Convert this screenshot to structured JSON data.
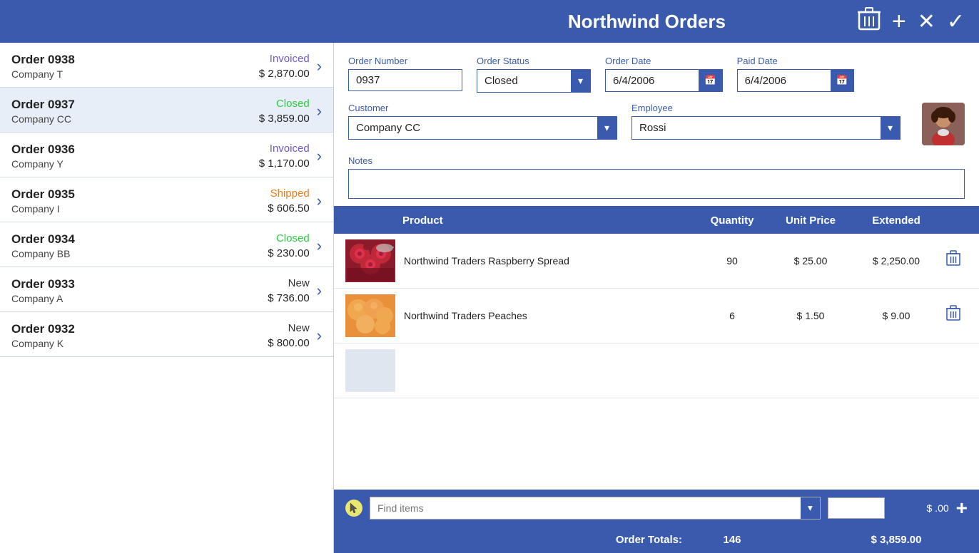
{
  "app": {
    "title": "Northwind Orders"
  },
  "header": {
    "delete_icon": "🗑",
    "add_icon": "+",
    "cancel_icon": "✕",
    "confirm_icon": "✓"
  },
  "orders": [
    {
      "id": "0938",
      "number": "Order 0938",
      "status": "Invoiced",
      "status_class": "status-invoiced",
      "company": "Company T",
      "amount": "$ 2,870.00"
    },
    {
      "id": "0937",
      "number": "Order 0937",
      "status": "Closed",
      "status_class": "status-closed",
      "company": "Company CC",
      "amount": "$ 3,859.00",
      "selected": true
    },
    {
      "id": "0936",
      "number": "Order 0936",
      "status": "Invoiced",
      "status_class": "status-invoiced",
      "company": "Company Y",
      "amount": "$ 1,170.00"
    },
    {
      "id": "0935",
      "number": "Order 0935",
      "status": "Shipped",
      "status_class": "status-shipped",
      "company": "Company I",
      "amount": "$ 606.50"
    },
    {
      "id": "0934",
      "number": "Order 0934",
      "status": "Closed",
      "status_class": "status-closed",
      "company": "Company BB",
      "amount": "$ 230.00"
    },
    {
      "id": "0933",
      "number": "Order 0933",
      "status": "New",
      "status_class": "status-new",
      "company": "Company A",
      "amount": "$ 736.00"
    },
    {
      "id": "0932",
      "number": "Order 0932",
      "status": "New",
      "status_class": "status-new",
      "company": "Company K",
      "amount": "$ 800.00"
    }
  ],
  "detail": {
    "order_number_label": "Order Number",
    "order_number_value": "0937",
    "order_status_label": "Order Status",
    "order_status_value": "Closed",
    "order_date_label": "Order Date",
    "order_date_value": "6/4/2006",
    "paid_date_label": "Paid Date",
    "paid_date_value": "6/4/2006",
    "customer_label": "Customer",
    "customer_value": "Company CC",
    "employee_label": "Employee",
    "employee_value": "Rossi",
    "notes_label": "Notes",
    "notes_value": ""
  },
  "products_table": {
    "col_product": "Product",
    "col_quantity": "Quantity",
    "col_unit_price": "Unit Price",
    "col_extended": "Extended"
  },
  "products": [
    {
      "name": "Northwind Traders Raspberry Spread",
      "quantity": "90",
      "unit_price": "$ 25.00",
      "extended": "$ 2,250.00",
      "image_color": "#c0304a",
      "image_type": "raspberry"
    },
    {
      "name": "Northwind Traders Peaches",
      "quantity": "6",
      "unit_price": "$ 1.50",
      "extended": "$ 9.00",
      "image_color": "#e8a030",
      "image_type": "peaches"
    },
    {
      "name": "",
      "quantity": "",
      "unit_price": "",
      "extended": "",
      "image_color": "#d0d0d0",
      "image_type": "blank"
    }
  ],
  "add_item": {
    "placeholder": "Find items",
    "dropdown_icon": "▾",
    "price": "$ .00",
    "add_icon": "+"
  },
  "totals": {
    "label": "Order Totals:",
    "quantity": "146",
    "amount": "$ 3,859.00"
  }
}
